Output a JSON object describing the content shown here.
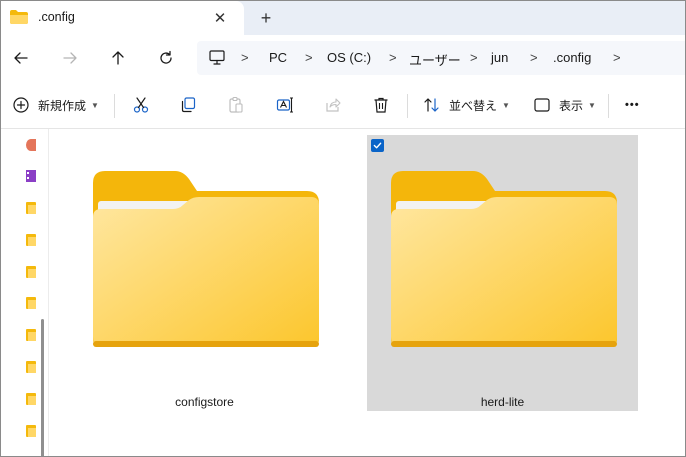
{
  "tab": {
    "title": ".config",
    "close_glyph": "✕",
    "new_tab_glyph": "+"
  },
  "nav": {
    "back_icon": "arrow-left-icon",
    "forward_icon": "arrow-right-icon",
    "up_icon": "arrow-up-icon",
    "refresh_icon": "refresh-icon"
  },
  "breadcrumb": {
    "separator": ">",
    "items": [
      "PC",
      "OS (C:)",
      "ユーザー",
      "jun",
      ".config"
    ]
  },
  "toolbar": {
    "new_label": "新規作成",
    "sort_label": "並べ替え",
    "view_label": "表示",
    "more_glyph": "•••"
  },
  "files": [
    {
      "name": "configstore",
      "selected": false
    },
    {
      "name": "herd-lite",
      "selected": true
    }
  ],
  "colors": {
    "accent": "#0a64c8",
    "folder_back": "#f4b90c",
    "folder_front_light": "#ffe38f",
    "folder_front_dark": "#fcc934",
    "selection": "#d9d9d9"
  }
}
